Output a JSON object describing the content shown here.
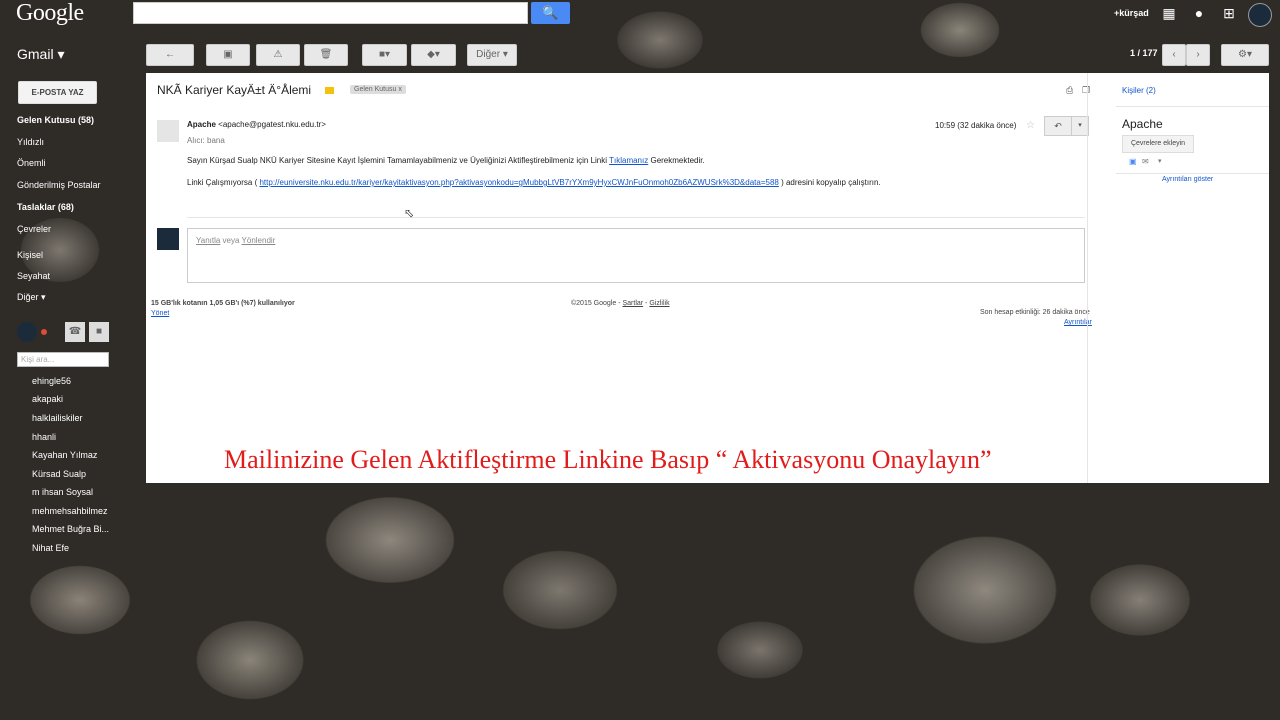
{
  "topbar": {
    "logo": "Google",
    "user": "+kürşad",
    "icons": [
      "apps-icon",
      "notifications-icon",
      "share-icon"
    ]
  },
  "toolbar": {
    "app_label": "Gmail ▾",
    "more_label": "Diğer ▾",
    "pager": "1 / 177"
  },
  "sidebar": {
    "compose": "E-POSTA YAZ",
    "items": [
      {
        "label": "Gelen Kutusu (58)",
        "bold": true
      },
      {
        "label": "Yıldızlı",
        "bold": false
      },
      {
        "label": "Önemli",
        "bold": false
      },
      {
        "label": "Gönderilmiş Postalar",
        "bold": false
      },
      {
        "label": "Taslaklar (68)",
        "bold": true
      },
      {
        "label": "Çevreler",
        "bold": false
      },
      {
        "label": "Kişisel",
        "bold": false
      },
      {
        "label": "Seyahat",
        "bold": false
      },
      {
        "label": "Diğer ▾",
        "bold": false
      }
    ],
    "chat_search_placeholder": "Kişi ara...",
    "contacts": [
      "ehingle56",
      "akapaki",
      "halklailiskiler",
      "hhanli",
      "Kayahan Yılmaz",
      "Kürsad Sualp",
      "m ihsan Soysal",
      "mehmehsahbilmez",
      "Mehmet Buğra Bi...",
      "Nihat Efe"
    ]
  },
  "message": {
    "subject": "NKÃ Kariyer KayÄ±t Ä°Ålemi",
    "label": "Gelen Kutusu",
    "label_close": "x",
    "sender_name": "Apache",
    "sender_email": "<apache@pgatest.nku.edu.tr>",
    "recipient": "Alıcı: bana",
    "time": "10:59 (32 dakika önce)",
    "body_line1_pre": "Sayın Kürşad Sualp NKÜ Kariyer Sitesine Kayıt İşlemini Tamamlayabilmeniz ve Üyeliğinizi Aktifleştirebilmeniz için Linki",
    "body_line1_link": "Tıklamanız",
    "body_line1_post": "Gerekmektedir.",
    "body_line2_pre": "Linki Çalışmıyorsa (",
    "body_line2_link": "http://euniversite.nku.edu.tr/kariyer/kayitaktivasyon.php?aktivasyonkodu=gMubbgLtVB7rYXm9yHyxCWJnFuOnmoh0Zb6AZWUSrk%3D&data=588",
    "body_line2_post": ") adresini kopyalıp çalıştırın.",
    "reply_text": "Yanıtla",
    "reply_or": "veya",
    "forward_text": "Yönlendir"
  },
  "footer": {
    "quota": "15 GB'lık kotanın 1,05 GB'ı (%7) kullanılıyor",
    "manage": "Yönet",
    "copyright": "©2015 Google -",
    "terms": "Şartlar",
    "privacy": "Gizlilik",
    "last_activity": "Son hesap etkinliği: 26 dakika önce",
    "details": "Ayrıntılar"
  },
  "people": {
    "title": "Kişiler (2)",
    "name": "Apache",
    "add_circles": "Çevrelere ekleyin",
    "details": "Ayrıntıları göster"
  },
  "overlay_caption": "Mailinizine Gelen Aktifleştirme Linkine Basıp “ Aktivasyonu Onaylayın”"
}
